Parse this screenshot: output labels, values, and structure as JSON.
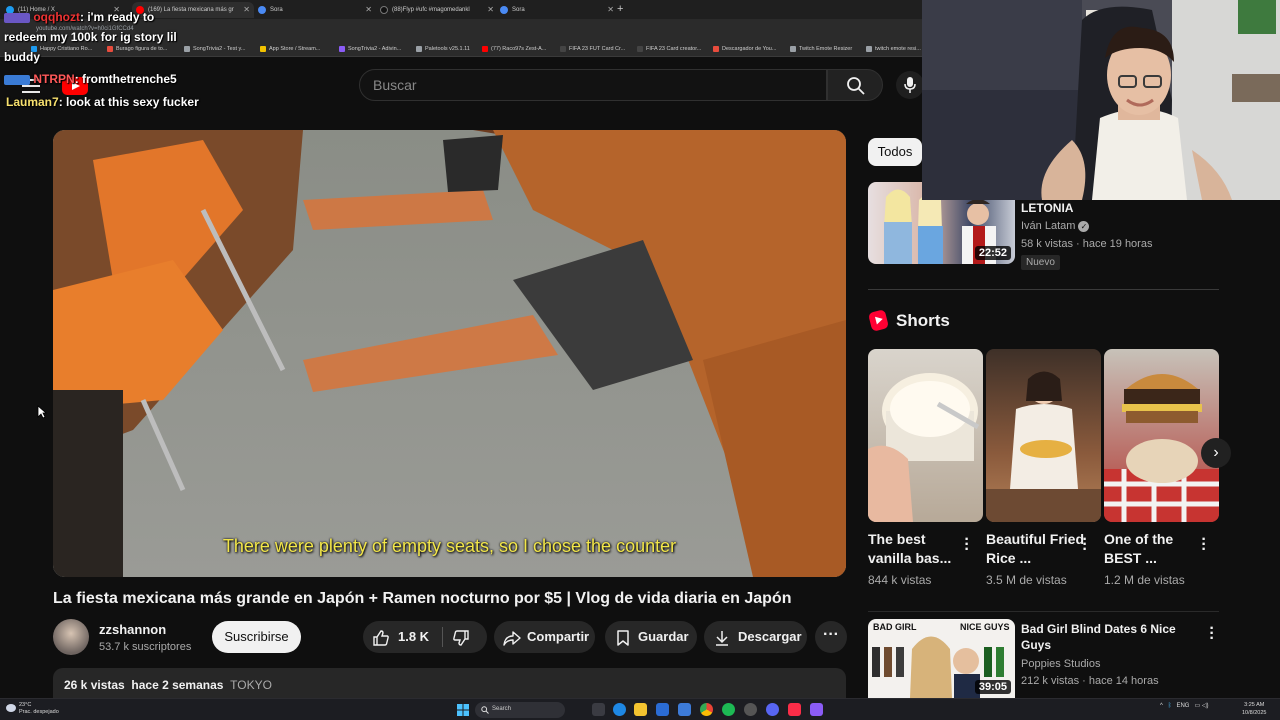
{
  "browser": {
    "tabs": [
      {
        "label": "(11) Home / X",
        "color": "#1d9bf0"
      },
      {
        "label": "(169) La fiesta mexicana más gr",
        "color": "#ff0000",
        "active": true
      },
      {
        "label": "Sora",
        "color": "#4a8af4"
      },
      {
        "label": "(88)Flyp #ufc #magomedankl",
        "color": "#111"
      },
      {
        "label": "Sora",
        "color": "#4a8af4"
      }
    ],
    "url": "youtube.com/watch?v=h0ci1GfCCd4",
    "bookmarks": [
      {
        "label": "Happy Cristiano Ro...",
        "color": "#1d9bf0"
      },
      {
        "label": "Burago figura de to...",
        "color": "#e84c3d"
      },
      {
        "label": "SongTrivia2 - Test y...",
        "color": "#9aa0a6"
      },
      {
        "label": "App Store / Stream...",
        "color": "#f2c200"
      },
      {
        "label": "SongTrivia2 - Adivin...",
        "color": "#8b5cf6"
      },
      {
        "label": "Paletools v25.1.11",
        "color": "#9aa0a6"
      },
      {
        "label": "(77) Raco97s Zest-A...",
        "color": "#ff0000"
      },
      {
        "label": "FIFA 23 FUT Card Cr...",
        "color": "#444"
      },
      {
        "label": "FIFA 23 Card creator...",
        "color": "#444"
      },
      {
        "label": "Descargador de You...",
        "color": "#e84c3d"
      },
      {
        "label": "Twitch Emote Resizer",
        "color": "#9aa0a6"
      },
      {
        "label": "twitch emote resi...",
        "color": "#9aa0a6"
      }
    ]
  },
  "chat": [
    {
      "user": "oqqhozt",
      "text": ": i'm ready to"
    },
    {
      "user": "",
      "text": "redeem my 100k for ig story lil"
    },
    {
      "user": "",
      "text": "buddy"
    },
    {
      "user": "NTRPN",
      "text": ": fromthetrenche5"
    },
    {
      "user": "Lauman7",
      "text": ": look at this sexy fucker"
    }
  ],
  "header": {
    "search_placeholder": "Buscar"
  },
  "video": {
    "subtitle": "There were plenty of empty seats, so I chose the counter",
    "title": "La fiesta mexicana más grande en Japón + Ramen nocturno por $5 | Vlog de vida diaria en Japón",
    "channel": "zzshannon",
    "subscribers": "53.7 k suscriptores",
    "subscribe_label": "Suscribirse",
    "likes": "1.8 K",
    "share_label": "Compartir",
    "save_label": "Guardar",
    "download_label": "Descargar",
    "more_label": "···",
    "views": "26 k vistas",
    "date": "hace 2 semanas",
    "tag": "TOKYO"
  },
  "sidebar": {
    "chip_all": "Todos",
    "recommended": [
      {
        "title": "LETONIA",
        "channel": "Iván Latam",
        "meta": "58 k vistas · hace 19 horas",
        "badge": "Nuevo",
        "duration": "22:52"
      },
      {
        "title": "Bad Girl Blind Dates 6 Nice Guys",
        "channel": "Poppies Studios",
        "meta": "212 k vistas · hace 14 horas",
        "duration": "39:05",
        "thumb_left": "BAD GIRL",
        "thumb_right": "NICE GUYS"
      }
    ],
    "shorts_heading": "Shorts",
    "shorts": [
      {
        "title": "The best vanilla bas...",
        "views": "844 k vistas"
      },
      {
        "title": "Beautiful Fried Rice ...",
        "views": "3.5 M de vistas"
      },
      {
        "title": "One of the BEST ...",
        "views": "1.2 M de vistas"
      }
    ]
  },
  "taskbar": {
    "weather_temp": "23°C",
    "weather_desc": "Prac. despejado",
    "search_label": "Search",
    "lang": "ENG",
    "time": "3:25 AM",
    "date": "10/8/2025"
  }
}
